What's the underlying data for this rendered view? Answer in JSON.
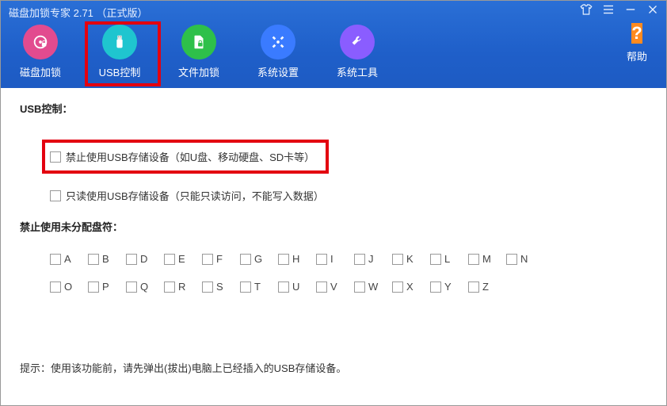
{
  "window": {
    "title": "磁盘加锁专家 2.71 （正式版）"
  },
  "toolbar": {
    "items": [
      {
        "label": "磁盘加锁"
      },
      {
        "label": "USB控制"
      },
      {
        "label": "文件加锁"
      },
      {
        "label": "系统设置"
      },
      {
        "label": "系统工具"
      }
    ],
    "help_label": "帮助"
  },
  "usb": {
    "section_title": "USB控制：",
    "opt_disable": "禁止使用USB存储设备（如U盘、移动硬盘、SD卡等）",
    "opt_readonly": "只读使用USB存储设备（只能只读访问，不能写入数据）"
  },
  "drives": {
    "section_title": "禁止使用未分配盘符：",
    "letters": [
      "A",
      "B",
      "D",
      "E",
      "F",
      "G",
      "H",
      "I",
      "J",
      "K",
      "L",
      "M",
      "N",
      "O",
      "P",
      "Q",
      "R",
      "S",
      "T",
      "U",
      "V",
      "W",
      "X",
      "Y",
      "Z"
    ]
  },
  "footer": {
    "tip": "提示：使用该功能前，请先弹出(拔出)电脑上已经插入的USB存储设备。"
  }
}
